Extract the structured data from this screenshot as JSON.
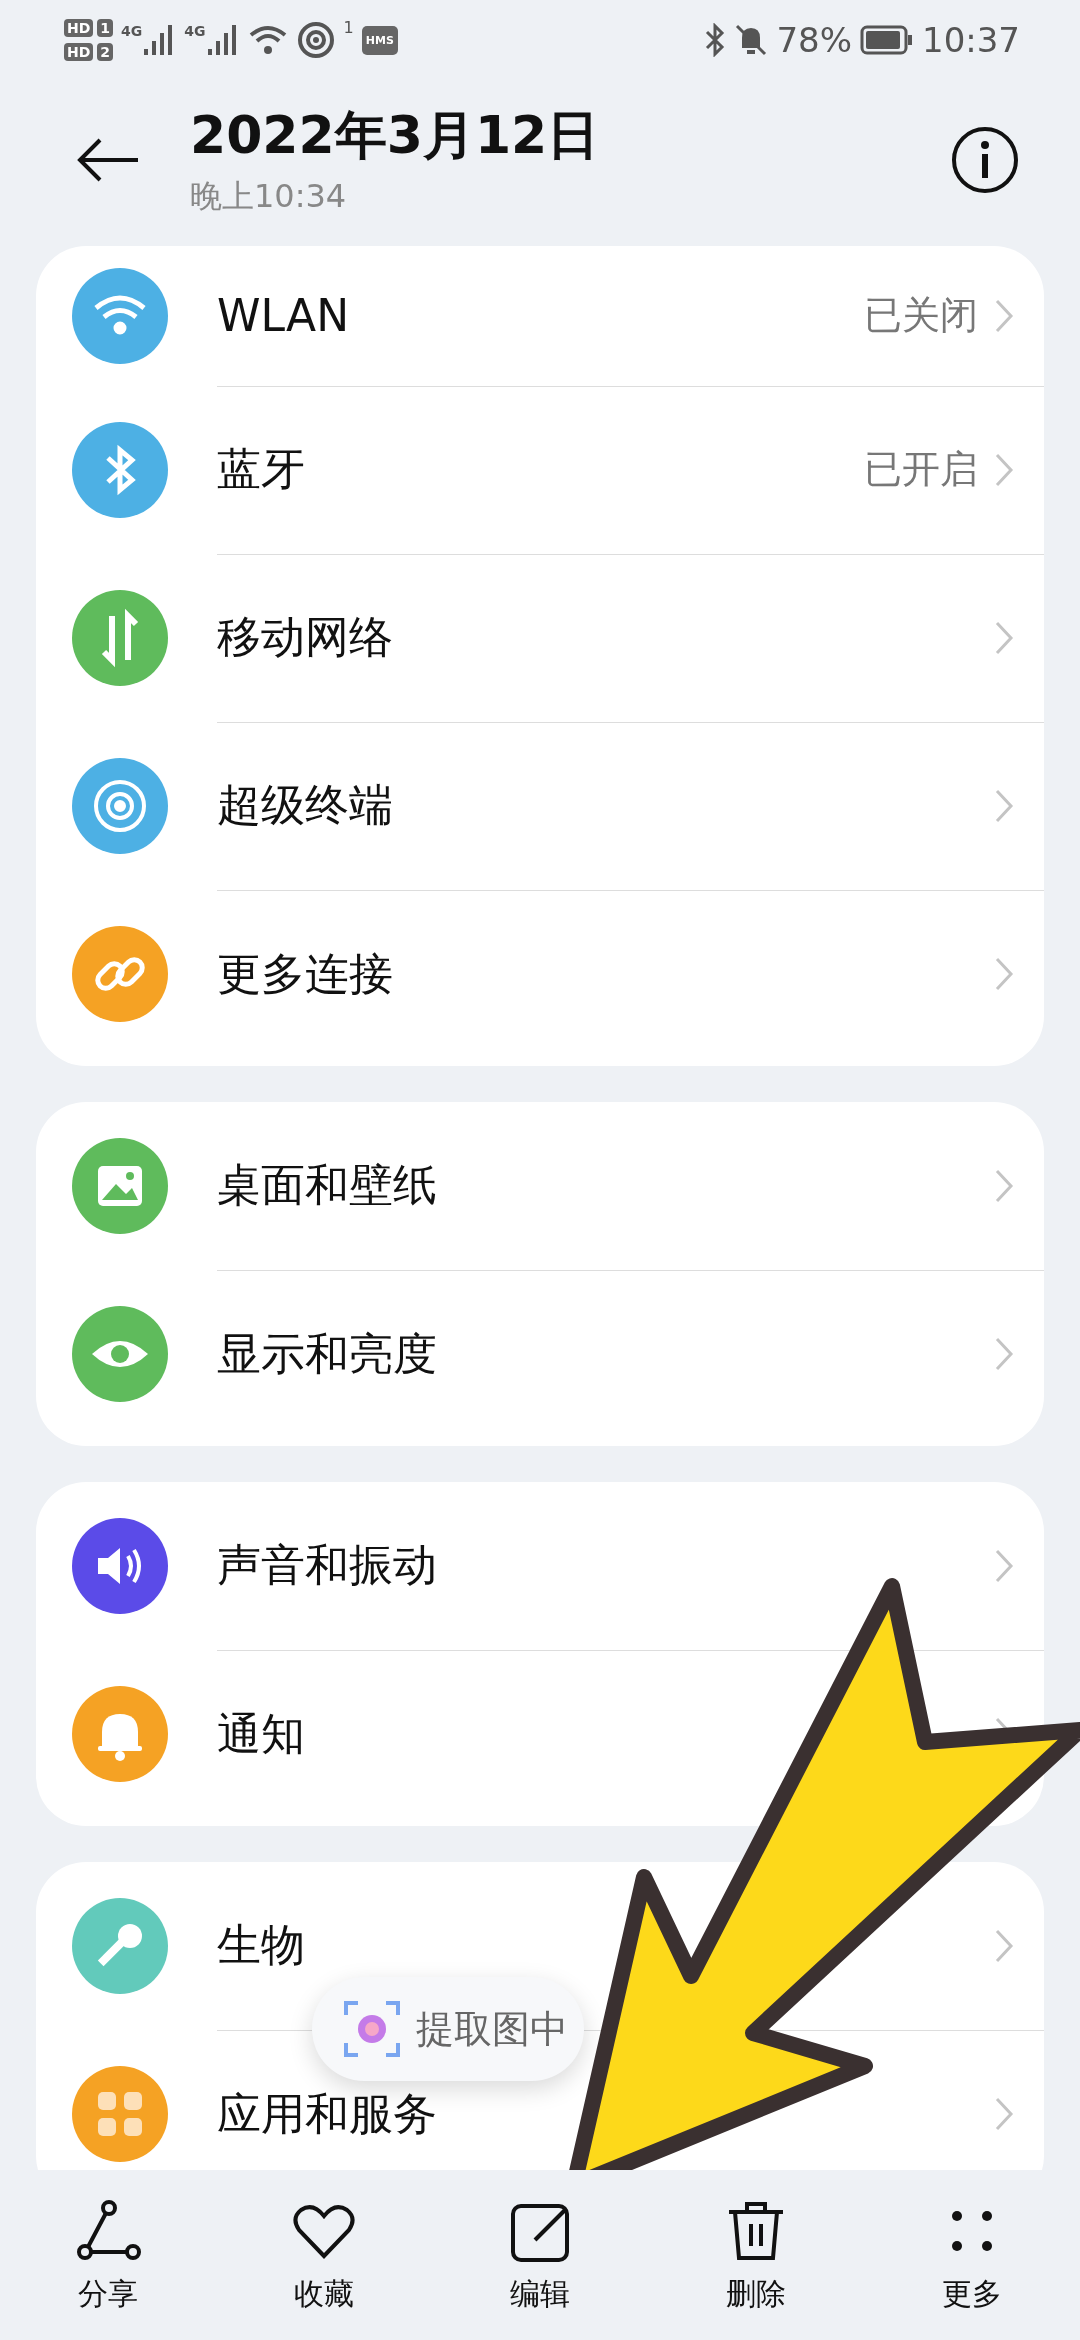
{
  "status_bar": {
    "sim_badges": [
      {
        "label": "HD",
        "slot": "1"
      },
      {
        "label": "HD",
        "slot": "2"
      }
    ],
    "network": [
      "4G",
      "4G"
    ],
    "hotspot_count": "1",
    "hms": "HMS",
    "battery": "78%",
    "time": "10:37"
  },
  "header": {
    "title": "2022年3月12日",
    "subtitle": "晚上10:34"
  },
  "groups": [
    {
      "items": [
        {
          "kind": "wifi",
          "label": "WLAN",
          "value": "已关闭",
          "color": "#4db0e4"
        },
        {
          "kind": "bluetooth",
          "label": "蓝牙",
          "value": "已开启",
          "color": "#4db0e4"
        },
        {
          "kind": "mobile",
          "label": "移动网络",
          "color": "#5fbb5c"
        },
        {
          "kind": "devices",
          "label": "超级终端",
          "color": "#4db0e4"
        },
        {
          "kind": "link",
          "label": "更多连接",
          "color": "#f5a224"
        }
      ]
    },
    {
      "items": [
        {
          "kind": "wallpaper",
          "label": "桌面和壁纸",
          "color": "#5fbb5c"
        },
        {
          "kind": "eye",
          "label": "显示和亮度",
          "color": "#5fbb5c"
        }
      ]
    },
    {
      "items": [
        {
          "kind": "sound",
          "label": "声音和振动",
          "color": "#5b4be8"
        },
        {
          "kind": "bell",
          "label": "通知",
          "color": "#f5a224"
        }
      ]
    },
    {
      "items": [
        {
          "kind": "key",
          "label": "生物",
          "color": "#62cabb"
        },
        {
          "kind": "apps",
          "label": "应用和服务",
          "color": "#f5a224"
        }
      ]
    }
  ],
  "text_pill": {
    "label": "提取图中"
  },
  "toolbar": [
    {
      "kind": "share",
      "label": "分享"
    },
    {
      "kind": "heart",
      "label": "收藏"
    },
    {
      "kind": "edit",
      "label": "编辑"
    },
    {
      "kind": "trash",
      "label": "删除"
    },
    {
      "kind": "more",
      "label": "更多"
    }
  ]
}
